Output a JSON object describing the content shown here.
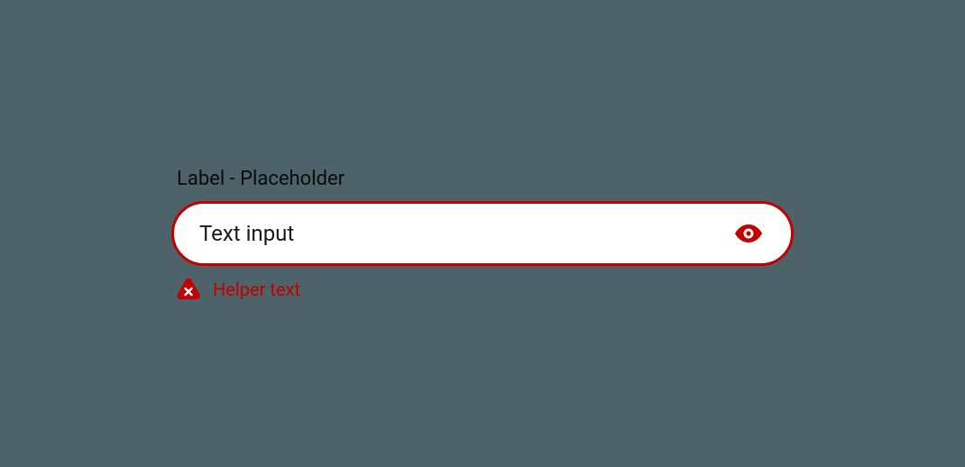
{
  "field": {
    "label": "Label - Placeholder",
    "value": "Text input",
    "placeholder": "",
    "helper": "Helper text"
  },
  "colors": {
    "error": "#c30000",
    "background": "#4d6269"
  }
}
